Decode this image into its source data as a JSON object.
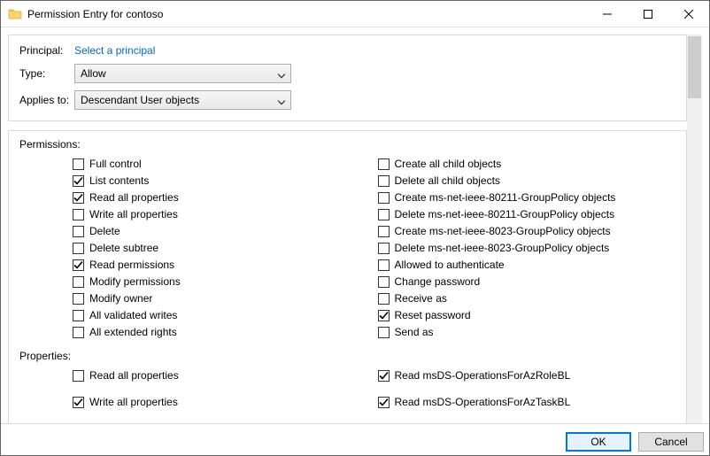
{
  "window": {
    "title": "Permission Entry for contoso"
  },
  "header": {
    "principal_label": "Principal:",
    "principal_link": "Select a principal",
    "type_label": "Type:",
    "type_value": "Allow",
    "applies_label": "Applies to:",
    "applies_value": "Descendant User objects"
  },
  "sections": {
    "permissions_label": "Permissions:",
    "properties_label": "Properties:"
  },
  "permissions_left": [
    {
      "label": "Full control",
      "checked": false
    },
    {
      "label": "List contents",
      "checked": true
    },
    {
      "label": "Read all properties",
      "checked": true
    },
    {
      "label": "Write all properties",
      "checked": false
    },
    {
      "label": "Delete",
      "checked": false
    },
    {
      "label": "Delete subtree",
      "checked": false
    },
    {
      "label": "Read permissions",
      "checked": true
    },
    {
      "label": "Modify permissions",
      "checked": false
    },
    {
      "label": "Modify owner",
      "checked": false
    },
    {
      "label": "All validated writes",
      "checked": false
    },
    {
      "label": "All extended rights",
      "checked": false
    }
  ],
  "permissions_right": [
    {
      "label": "Create all child objects",
      "checked": false
    },
    {
      "label": "Delete all child objects",
      "checked": false
    },
    {
      "label": "Create ms-net-ieee-80211-GroupPolicy objects",
      "checked": false
    },
    {
      "label": "Delete ms-net-ieee-80211-GroupPolicy objects",
      "checked": false
    },
    {
      "label": "Create ms-net-ieee-8023-GroupPolicy objects",
      "checked": false
    },
    {
      "label": "Delete ms-net-ieee-8023-GroupPolicy objects",
      "checked": false
    },
    {
      "label": "Allowed to authenticate",
      "checked": false
    },
    {
      "label": "Change password",
      "checked": false
    },
    {
      "label": "Receive as",
      "checked": false
    },
    {
      "label": "Reset password",
      "checked": true
    },
    {
      "label": "Send as",
      "checked": false
    }
  ],
  "properties_left": [
    {
      "label": "Read all properties",
      "checked": false
    },
    {
      "label": "Write all properties",
      "checked": true
    }
  ],
  "properties_right": [
    {
      "label": "Read msDS-OperationsForAzRoleBL",
      "checked": true
    },
    {
      "label": "Read msDS-OperationsForAzTaskBL",
      "checked": true
    }
  ],
  "footer": {
    "ok": "OK",
    "cancel": "Cancel"
  }
}
